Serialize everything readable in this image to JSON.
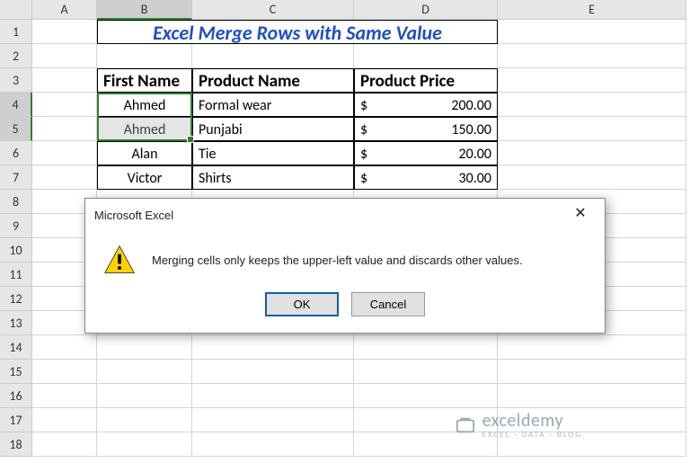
{
  "columns": [
    "A",
    "B",
    "C",
    "D",
    "E"
  ],
  "rows": [
    "1",
    "2",
    "3",
    "4",
    "5",
    "6",
    "7",
    "8",
    "9",
    "10",
    "11",
    "12",
    "13",
    "14",
    "15",
    "16",
    "17",
    "18"
  ],
  "title": "Excel Merge Rows with Same Value",
  "headers": {
    "first": "First Name",
    "product": "Product Name",
    "price": "Product Price"
  },
  "data": [
    {
      "first": "Ahmed",
      "product": "Formal wear",
      "currency": "$",
      "price": "200.00"
    },
    {
      "first": "Ahmed",
      "product": "Punjabi",
      "currency": "$",
      "price": "150.00"
    },
    {
      "first": "Alan",
      "product": "Tie",
      "currency": "$",
      "price": "20.00"
    },
    {
      "first": "Victor",
      "product": "Shirts",
      "currency": "$",
      "price": "30.00"
    }
  ],
  "dialog": {
    "title": "Microsoft Excel",
    "message": "Merging cells only keeps the upper-left value and discards other values.",
    "ok": "OK",
    "cancel": "Cancel"
  },
  "watermark": {
    "name": "exceldemy",
    "sub": "EXCEL · DATA · BLOG"
  },
  "chart_data": {
    "type": "table",
    "columns": [
      "First Name",
      "Product Name",
      "Product Price"
    ],
    "rows": [
      [
        "Ahmed",
        "Formal wear",
        200.0
      ],
      [
        "Ahmed",
        "Punjabi",
        150.0
      ],
      [
        "Alan",
        "Tie",
        20.0
      ],
      [
        "Victor",
        "Shirts",
        30.0
      ]
    ],
    "currency": "USD"
  }
}
